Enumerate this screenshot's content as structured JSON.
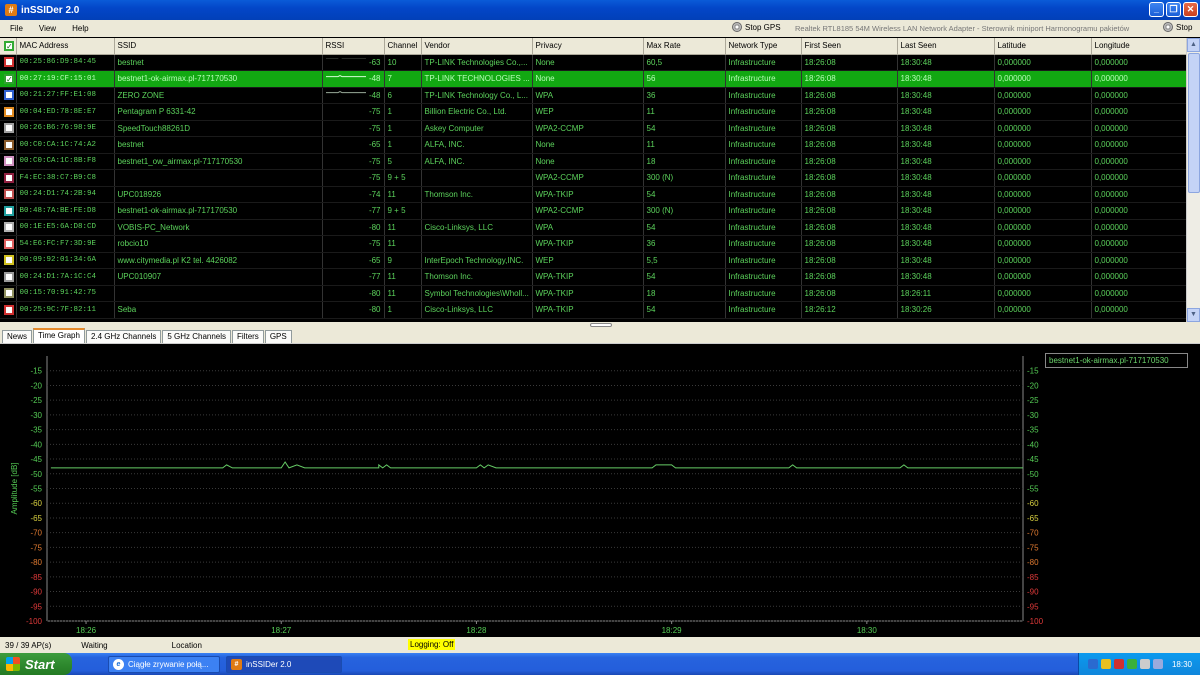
{
  "window": {
    "title": "inSSIDer 2.0",
    "icon": "inssider-icon",
    "controls": [
      "_",
      "❐",
      "✕"
    ]
  },
  "menu": {
    "items": [
      "File",
      "View",
      "Help"
    ],
    "stop_gps": "Stop GPS",
    "adapter": "Realtek RTL8185 54M Wireless LAN Network Adapter - Sterownik miniport Harmonogramu pakietów",
    "stop": "Stop"
  },
  "table": {
    "columns": [
      "MAC Address",
      "SSID",
      "RSSI",
      "Channel",
      "Vendor",
      "Privacy",
      "Max Rate",
      "Network Type",
      "First Seen",
      "Last Seen",
      "Latitude",
      "Longitude"
    ],
    "rows": [
      {
        "color": "#d03030",
        "checked": false,
        "mac": "00:25:86:D9:84:45",
        "ssid": "bestnet",
        "rssi": "-63",
        "channel": "10",
        "vendor": "TP-LINK Technologies Co.,...",
        "privacy": "None",
        "rate": "60,5",
        "type": "Infrastructure",
        "first": "18:26:08",
        "last": "18:30:48",
        "lat": "0,000000",
        "lon": "0,000000"
      },
      {
        "color": "#30a030",
        "checked": true,
        "mac": "00:27:19:CF:15:01",
        "ssid": "bestnet1-ok-airmax.pl-717170530",
        "rssi": "-48",
        "channel": "7",
        "vendor": "TP-LINK TECHNOLOGIES ...",
        "privacy": "None",
        "rate": "56",
        "type": "Infrastructure",
        "first": "18:26:08",
        "last": "18:30:48",
        "lat": "0,000000",
        "lon": "0,000000"
      },
      {
        "color": "#3060d0",
        "checked": false,
        "mac": "00:21:27:FF:E1:08",
        "ssid": "ZERO ZONE",
        "rssi": "-48",
        "channel": "6",
        "vendor": "TP-LINK Technology Co., L...",
        "privacy": "WPA",
        "rate": "36",
        "type": "Infrastructure",
        "first": "18:26:08",
        "last": "18:30:48",
        "lat": "0,000000",
        "lon": "0,000000"
      },
      {
        "color": "#e08a20",
        "checked": false,
        "mac": "00:04:ED:78:8E:E7",
        "ssid": "Pentagram P 6331-42",
        "rssi": "-75",
        "channel": "1",
        "vendor": "Billion Electric Co., Ltd.",
        "privacy": "WEP",
        "rate": "11",
        "type": "Infrastructure",
        "first": "18:26:08",
        "last": "18:30:48",
        "lat": "0,000000",
        "lon": "0,000000"
      },
      {
        "color": "#a0a0a0",
        "checked": false,
        "mac": "00:26:B6:76:98:9E",
        "ssid": "SpeedTouch88261D",
        "rssi": "-75",
        "channel": "1",
        "vendor": "Askey Computer",
        "privacy": "WPA2-CCMP",
        "rate": "54",
        "type": "Infrastructure",
        "first": "18:26:08",
        "last": "18:30:48",
        "lat": "0,000000",
        "lon": "0,000000"
      },
      {
        "color": "#8a5a2a",
        "checked": false,
        "mac": "00:C0:CA:1C:74:A2",
        "ssid": "bestnet",
        "rssi": "-65",
        "channel": "1",
        "vendor": "ALFA, INC.",
        "privacy": "None",
        "rate": "11",
        "type": "Infrastructure",
        "first": "18:26:08",
        "last": "18:30:48",
        "lat": "0,000000",
        "lon": "0,000000"
      },
      {
        "color": "#d090c0",
        "checked": false,
        "mac": "00:C0:CA:1C:8B:F8",
        "ssid": "bestnet1_ow_airmax.pl-717170530",
        "rssi": "-75",
        "channel": "5",
        "vendor": "ALFA, INC.",
        "privacy": "None",
        "rate": "18",
        "type": "Infrastructure",
        "first": "18:26:08",
        "last": "18:30:48",
        "lat": "0,000000",
        "lon": "0,000000"
      },
      {
        "color": "#902040",
        "checked": false,
        "mac": "F4:EC:38:C7:B9:C8",
        "ssid": "",
        "rssi": "-75",
        "channel": "9 + 5",
        "vendor": "",
        "privacy": "WPA2-CCMP",
        "rate": "300 (N)",
        "type": "Infrastructure",
        "first": "18:26:08",
        "last": "18:30:48",
        "lat": "0,000000",
        "lon": "0,000000"
      },
      {
        "color": "#c05050",
        "checked": false,
        "mac": "00:24:D1:74:2B:94",
        "ssid": "UPC018926",
        "rssi": "-74",
        "channel": "11",
        "vendor": "Thomson Inc.",
        "privacy": "WPA-TKIP",
        "rate": "54",
        "type": "Infrastructure",
        "first": "18:26:08",
        "last": "18:30:48",
        "lat": "0,000000",
        "lon": "0,000000"
      },
      {
        "color": "#20a0a0",
        "checked": false,
        "mac": "B0:48:7A:BE:FE:D8",
        "ssid": "bestnet1-ok-airmax.pl-717170530",
        "rssi": "-77",
        "channel": "9 + 5",
        "vendor": "",
        "privacy": "WPA2-CCMP",
        "rate": "300 (N)",
        "type": "Infrastructure",
        "first": "18:26:08",
        "last": "18:30:48",
        "lat": "0,000000",
        "lon": "0,000000"
      },
      {
        "color": "#b0b0b0",
        "checked": false,
        "mac": "00:1E:E5:6A:D8:CD",
        "ssid": "VOBIS-PC_Network",
        "rssi": "-80",
        "channel": "11",
        "vendor": "Cisco-Linksys, LLC",
        "privacy": "WPA",
        "rate": "54",
        "type": "Infrastructure",
        "first": "18:26:08",
        "last": "18:30:48",
        "lat": "0,000000",
        "lon": "0,000000"
      },
      {
        "color": "#e06060",
        "checked": false,
        "mac": "54:E6:FC:F7:3D:9E",
        "ssid": "robcio10",
        "rssi": "-75",
        "channel": "11",
        "vendor": "",
        "privacy": "WPA-TKIP",
        "rate": "36",
        "type": "Infrastructure",
        "first": "18:26:08",
        "last": "18:30:48",
        "lat": "0,000000",
        "lon": "0,000000"
      },
      {
        "color": "#d0c020",
        "checked": false,
        "mac": "00:09:92:01:34:6A",
        "ssid": "www.citymedia.pl K2 tel. 4426082",
        "rssi": "-65",
        "channel": "9",
        "vendor": "InterEpoch Technology,INC.",
        "privacy": "WEP",
        "rate": "5,5",
        "type": "Infrastructure",
        "first": "18:26:08",
        "last": "18:30:48",
        "lat": "0,000000",
        "lon": "0,000000"
      },
      {
        "color": "#9a9a9a",
        "checked": false,
        "mac": "00:24:D1:7A:1C:C4",
        "ssid": "UPC010907",
        "rssi": "-77",
        "channel": "11",
        "vendor": "Thomson Inc.",
        "privacy": "WPA-TKIP",
        "rate": "54",
        "type": "Infrastructure",
        "first": "18:26:08",
        "last": "18:30:48",
        "lat": "0,000000",
        "lon": "0,000000"
      },
      {
        "color": "#909060",
        "checked": false,
        "mac": "00:15:70:91:42:75",
        "ssid": "",
        "rssi": "-80",
        "channel": "11",
        "vendor": "Symbol Technologies\\Wholl...",
        "privacy": "WPA-TKIP",
        "rate": "18",
        "type": "Infrastructure",
        "first": "18:26:08",
        "last": "18:26:11",
        "lat": "0,000000",
        "lon": "0,000000"
      },
      {
        "color": "#d03030",
        "checked": false,
        "mac": "00:25:9C:7F:82:11",
        "ssid": "Seba",
        "rssi": "-80",
        "channel": "1",
        "vendor": "Cisco-Linksys, LLC",
        "privacy": "WPA-TKIP",
        "rate": "54",
        "type": "Infrastructure",
        "first": "18:26:12",
        "last": "18:30:26",
        "lat": "0,000000",
        "lon": "0,000000"
      }
    ]
  },
  "tabs": [
    {
      "label": "News",
      "active": false
    },
    {
      "label": "Time Graph",
      "active": true
    },
    {
      "label": "2.4 GHz Channels",
      "active": false
    },
    {
      "label": "5 GHz Channels",
      "active": false
    },
    {
      "label": "Filters",
      "active": false
    },
    {
      "label": "GPS",
      "active": false
    }
  ],
  "chart_data": {
    "type": "line",
    "ylabel": "Amplitude [dB]",
    "ylim": [
      -100,
      -10
    ],
    "yticks": [
      -15,
      -20,
      -25,
      -30,
      -35,
      -40,
      -45,
      -50,
      -55,
      -60,
      -65,
      -70,
      -75,
      -80,
      -85,
      -90,
      -95,
      -100
    ],
    "xticks": [
      "18:26",
      "18:27",
      "18:28",
      "18:29",
      "18:30"
    ],
    "xrange_min": [
      25.8,
      30.8
    ],
    "grid": true,
    "legend_position": "top-right",
    "series": [
      {
        "name": "bestnet1-ok-airmax.pl-717170530",
        "color": "#66cc66",
        "x_min": [
          25.82,
          26.7,
          26.72,
          26.75,
          27.0,
          27.02,
          27.04,
          27.08,
          27.12,
          27.5,
          27.5,
          27.52,
          27.54,
          27.56,
          28.0,
          28.02,
          28.04,
          28.06,
          28.1,
          28.9,
          28.92,
          29.0,
          29.02,
          29.4,
          29.6,
          29.62,
          29.64,
          29.7,
          30.17,
          30.19,
          30.21,
          30.8
        ],
        "y": [
          -48,
          -48,
          -47,
          -48,
          -48,
          -46,
          -48,
          -47,
          -48,
          -48,
          -47,
          -48,
          -47,
          -48,
          -48,
          -47,
          -48,
          -47,
          -48,
          -48,
          -47,
          -47,
          -48,
          -48,
          -48,
          -47,
          -48,
          -48,
          -48,
          -47,
          -48,
          -48
        ]
      }
    ]
  },
  "status": {
    "ap_count": "39 / 39 AP(s)",
    "state": "Waiting",
    "location": "Location",
    "logging": "Logging: Off"
  },
  "taskbar": {
    "start": "Start",
    "tasks": [
      {
        "label": "Ciągłe zrywanie połą...",
        "icon": "ie-icon",
        "active": false
      },
      {
        "label": "inSSIDer 2.0",
        "icon": "inssider-icon",
        "active": true
      }
    ],
    "clock": "18:30"
  }
}
